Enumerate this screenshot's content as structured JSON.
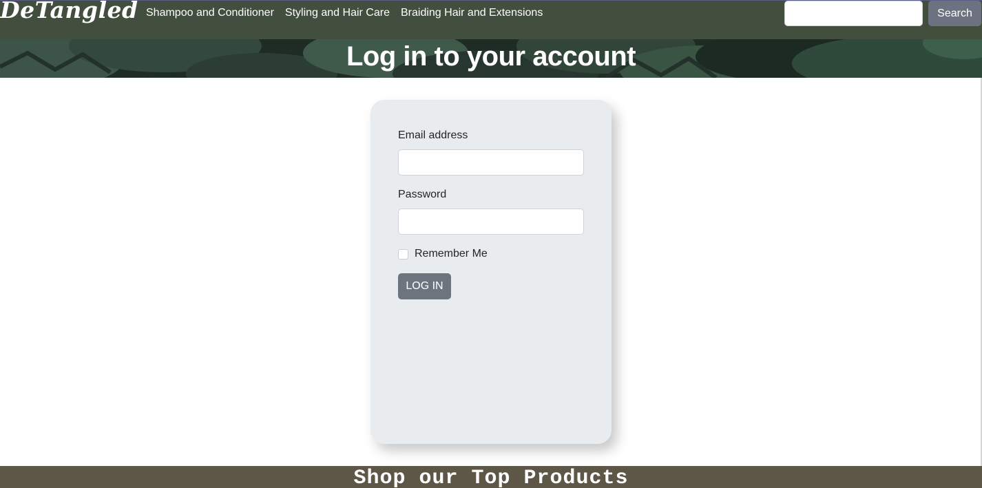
{
  "navbar": {
    "brand": "DeTangled",
    "links": [
      "Shampoo and Conditioner",
      "Styling and Hair Care",
      "Braiding Hair and Extensions"
    ],
    "search": {
      "value": "",
      "placeholder": "",
      "button_label": "Search"
    }
  },
  "hero": {
    "title": "Log in to your account"
  },
  "login_form": {
    "email_label": "Email address",
    "email_value": "",
    "password_label": "Password",
    "password_value": "",
    "remember_label": "Remember Me",
    "remember_checked": false,
    "submit_label": "LOG IN"
  },
  "shop_banner": {
    "title": "Shop our Top Products"
  },
  "colors": {
    "navbar_bg": "#424f3e",
    "card_bg": "#e9ecef",
    "button_bg": "#6c757d",
    "search_button_bg": "#6c7280",
    "shop_banner_bg": "#5e5748"
  }
}
